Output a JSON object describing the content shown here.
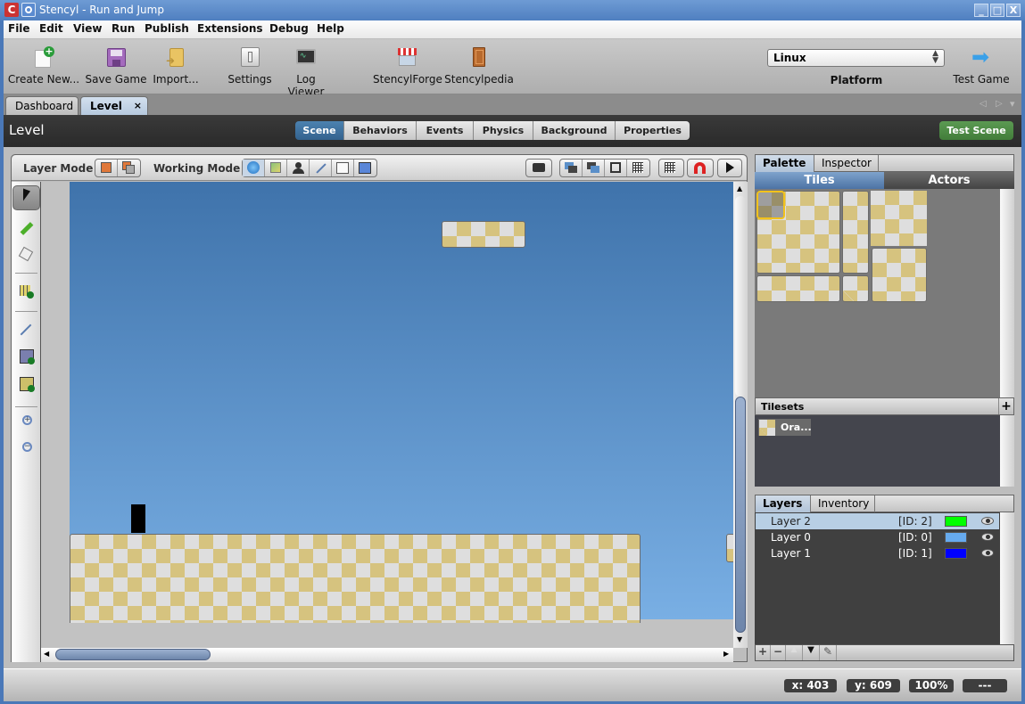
{
  "window": {
    "title": "Stencyl - Run and Jump",
    "controls": [
      "minimize",
      "maximize",
      "close"
    ],
    "control_glyphs": {
      "minimize": "_",
      "maximize": "□",
      "close": "X"
    }
  },
  "menu": [
    "File",
    "Edit",
    "View",
    "Run",
    "Publish",
    "Extensions",
    "Debug",
    "Help"
  ],
  "toolbar": {
    "create_new": "Create New...",
    "save_game": "Save Game",
    "import": "Import...",
    "settings": "Settings",
    "log_viewer": "Log Viewer",
    "stencylforge": "StencylForge",
    "stencylpedia": "Stencylpedia",
    "platform_value": "Linux",
    "platform_label": "Platform",
    "test_game": "Test Game"
  },
  "doc_tabs": [
    {
      "label": "Dashboard",
      "active": false
    },
    {
      "label": "Level",
      "active": true,
      "close_glyph": "×"
    }
  ],
  "tab_nav_glyphs": {
    "prev": "◁",
    "next": "▷",
    "menu": "▾"
  },
  "header": {
    "title": "Level",
    "segments": [
      "Scene",
      "Behaviors",
      "Events",
      "Physics",
      "Background",
      "Properties"
    ],
    "active_segment": "Scene",
    "test_scene": "Test Scene"
  },
  "modebar": {
    "layer_mode_label": "Layer Mode",
    "working_mode_label": "Working Mode"
  },
  "left_tools": [
    "select",
    "pencil",
    "bucket-fill",
    "tile-grid",
    "joint",
    "region",
    "terrain",
    "zoom-in",
    "zoom-out"
  ],
  "right_panel": {
    "top_tabs": [
      "Palette",
      "Inspector"
    ],
    "active_top_tab": "Palette",
    "sub_tabs": [
      "Tiles",
      "Actors"
    ],
    "active_sub_tab": "Tiles",
    "tilesets_label": "Tilesets",
    "tilesets_add": "+",
    "tileset_items": [
      "Ora..."
    ],
    "bottom_tabs": [
      "Layers",
      "Inventory"
    ],
    "active_bottom_tab": "Layers",
    "layers": [
      {
        "name": "Layer 2",
        "id": "[ID: 2]",
        "color": "#00ff00",
        "selected": true
      },
      {
        "name": "Layer 0",
        "id": "[ID: 0]",
        "color": "#66aaee",
        "selected": false
      },
      {
        "name": "Layer 1",
        "id": "[ID: 1]",
        "color": "#0000ff",
        "selected": false
      }
    ],
    "layer_buttons": [
      "+",
      "−",
      "▲",
      "▼",
      "✎"
    ]
  },
  "status": {
    "x": "x: 403",
    "y": "y: 609",
    "zoom": "100%",
    "extra": "---"
  },
  "colors": {
    "accent_blue": "#3d6e9c",
    "test_scene_green": "#4f8a47",
    "selection_yellow": "#f2c21b"
  }
}
